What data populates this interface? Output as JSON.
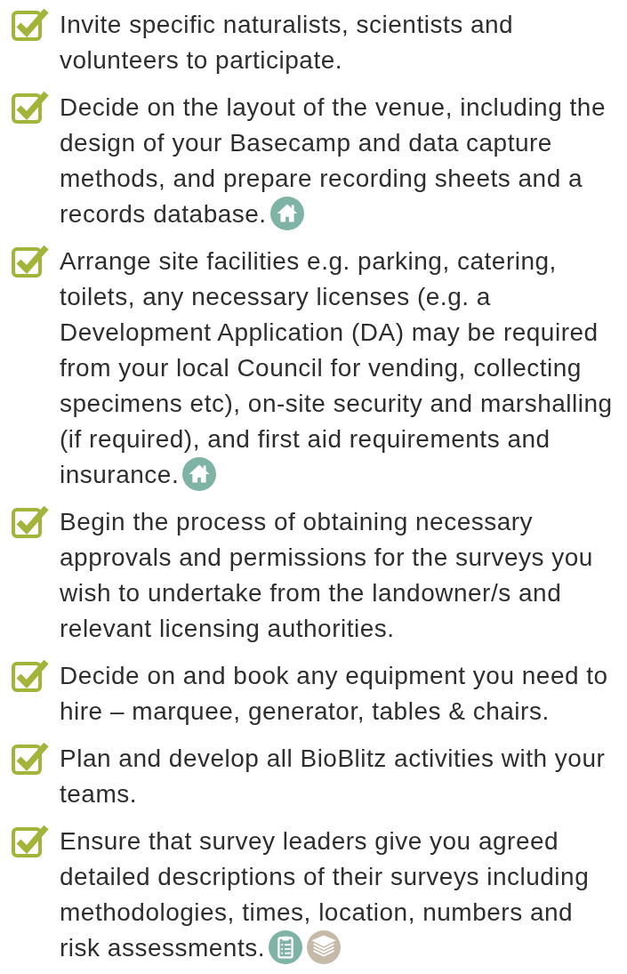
{
  "checklist": [
    {
      "text": "Invite specific naturalists, scientists and volunteers to participate.",
      "checked": true
    },
    {
      "text": "Decide on the layout of the venue, including the design of your Basecamp and data capture methods, and prepare recording sheets and a records database.",
      "checked": true,
      "icons": [
        {
          "kind": "home",
          "color": "#7fb3a5"
        }
      ]
    },
    {
      "text": "Arrange site facilities e.g. parking, catering, toilets, any necessary licenses (e.g. a Development Application (DA) may be required from your local Council for vending, collecting specimens etc), on-site security and marshalling (if required), and first aid requirements and insurance.",
      "checked": true,
      "icons": [
        {
          "kind": "home",
          "color": "#7fb3a5"
        }
      ]
    },
    {
      "text": "Begin the process of obtaining necessary approvals and permissions for the surveys you wish to undertake from the landowner/s and relevant licensing authorities.",
      "checked": true
    },
    {
      "text": "Decide on and book any equipment you need to hire – marquee, generator, tables & chairs.",
      "checked": true
    },
    {
      "text": "Plan and develop all BioBlitz activities with your teams.",
      "checked": true
    },
    {
      "text": "Ensure that survey leaders give you agreed detailed descriptions of their surveys including methodologies, times, location, numbers and risk assessments.",
      "checked": true,
      "icons": [
        {
          "kind": "clipboard",
          "color": "#7fb3a5"
        },
        {
          "kind": "stack",
          "color": "#c5baa8"
        }
      ]
    }
  ]
}
